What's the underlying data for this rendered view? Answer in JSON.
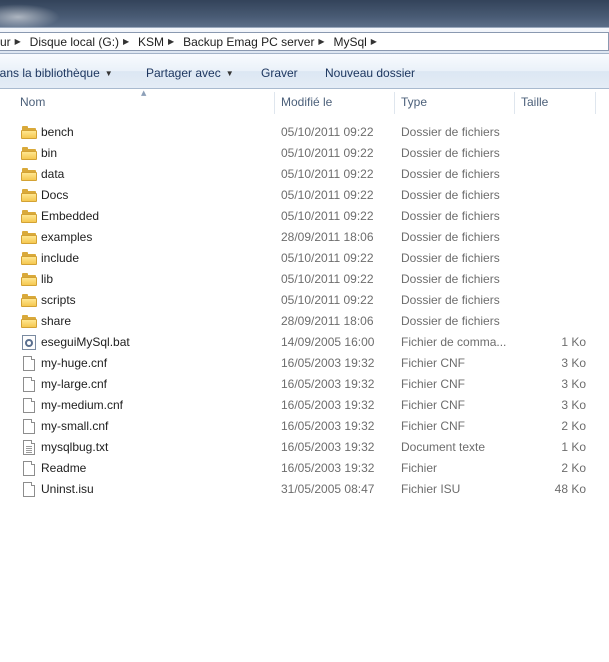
{
  "address": {
    "crumbs": [
      "ur",
      "Disque local (G:)",
      "KSM",
      "Backup Emag PC server",
      "MySql"
    ]
  },
  "commandbar": {
    "library": "lans la bibliothèque",
    "share": "Partager avec",
    "burn": "Graver",
    "new_folder": "Nouveau dossier"
  },
  "columns": {
    "name": "Nom",
    "modified": "Modifié le",
    "type": "Type",
    "size": "Taille"
  },
  "files": [
    {
      "name": "bench",
      "date": "05/10/2011 09:22",
      "type": "Dossier de fichiers",
      "size": "",
      "icon": "folder-icon"
    },
    {
      "name": "bin",
      "date": "05/10/2011 09:22",
      "type": "Dossier de fichiers",
      "size": "",
      "icon": "folder-icon"
    },
    {
      "name": "data",
      "date": "05/10/2011 09:22",
      "type": "Dossier de fichiers",
      "size": "",
      "icon": "folder-icon"
    },
    {
      "name": "Docs",
      "date": "05/10/2011 09:22",
      "type": "Dossier de fichiers",
      "size": "",
      "icon": "folder-icon"
    },
    {
      "name": "Embedded",
      "date": "05/10/2011 09:22",
      "type": "Dossier de fichiers",
      "size": "",
      "icon": "folder-icon"
    },
    {
      "name": "examples",
      "date": "28/09/2011 18:06",
      "type": "Dossier de fichiers",
      "size": "",
      "icon": "folder-icon"
    },
    {
      "name": "include",
      "date": "05/10/2011 09:22",
      "type": "Dossier de fichiers",
      "size": "",
      "icon": "folder-icon"
    },
    {
      "name": "lib",
      "date": "05/10/2011 09:22",
      "type": "Dossier de fichiers",
      "size": "",
      "icon": "folder-icon"
    },
    {
      "name": "scripts",
      "date": "05/10/2011 09:22",
      "type": "Dossier de fichiers",
      "size": "",
      "icon": "folder-icon"
    },
    {
      "name": "share",
      "date": "28/09/2011 18:06",
      "type": "Dossier de fichiers",
      "size": "",
      "icon": "folder-icon"
    },
    {
      "name": "eseguiMySql.bat",
      "date": "14/09/2005 16:00",
      "type": "Fichier de comma...",
      "size": "1 Ko",
      "icon": "batch-file-icon"
    },
    {
      "name": "my-huge.cnf",
      "date": "16/05/2003 19:32",
      "type": "Fichier CNF",
      "size": "3 Ko",
      "icon": "document-icon"
    },
    {
      "name": "my-large.cnf",
      "date": "16/05/2003 19:32",
      "type": "Fichier CNF",
      "size": "3 Ko",
      "icon": "document-icon"
    },
    {
      "name": "my-medium.cnf",
      "date": "16/05/2003 19:32",
      "type": "Fichier CNF",
      "size": "3 Ko",
      "icon": "document-icon"
    },
    {
      "name": "my-small.cnf",
      "date": "16/05/2003 19:32",
      "type": "Fichier CNF",
      "size": "2 Ko",
      "icon": "document-icon"
    },
    {
      "name": "mysqlbug.txt",
      "date": "16/05/2003 19:32",
      "type": "Document texte",
      "size": "1 Ko",
      "icon": "text-document-icon"
    },
    {
      "name": "Readme",
      "date": "16/05/2003 19:32",
      "type": "Fichier",
      "size": "2 Ko",
      "icon": "document-icon"
    },
    {
      "name": "Uninst.isu",
      "date": "31/05/2005 08:47",
      "type": "Fichier ISU",
      "size": "48 Ko",
      "icon": "document-icon"
    }
  ]
}
